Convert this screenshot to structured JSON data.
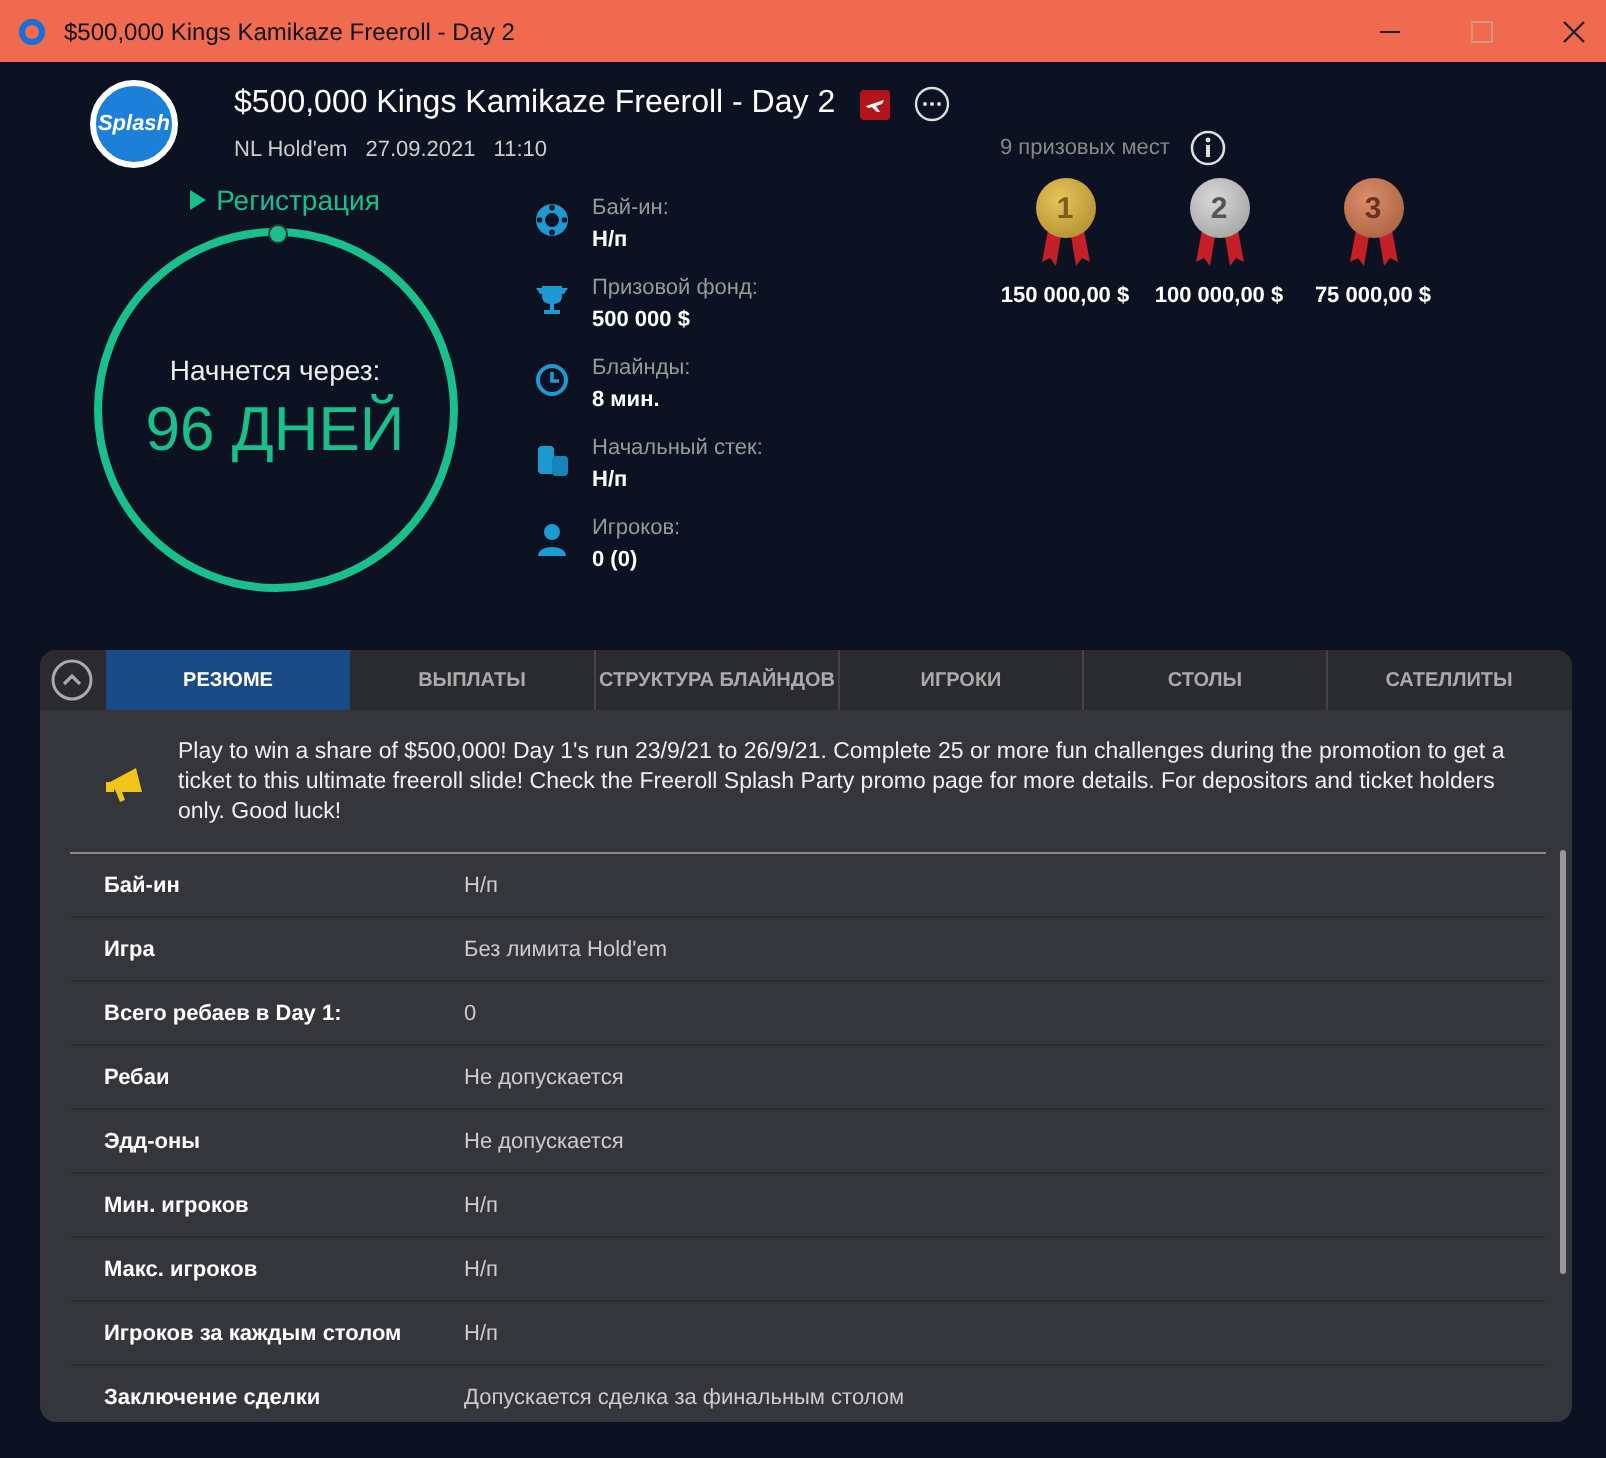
{
  "window": {
    "title": "$500,000 Kings Kamikaze Freeroll - Day 2"
  },
  "header": {
    "logo": "Splash",
    "title": "$500,000 Kings Kamikaze Freeroll - Day 2",
    "game": "NL Hold'em",
    "date": "27.09.2021",
    "time": "11:10"
  },
  "registration": {
    "label": "Регистрация",
    "countdown_label": "Начнется через:",
    "countdown": "96 ДНЕЙ"
  },
  "stats": [
    {
      "kind": "chip",
      "label": "Бай-ин:",
      "value": "Н/п"
    },
    {
      "kind": "trophy",
      "label": "Призовой фонд:",
      "value": "500 000 $"
    },
    {
      "kind": "clock",
      "label": "Блайнды:",
      "value": "8 мин."
    },
    {
      "kind": "coins",
      "label": "Начальный стек:",
      "value": "Н/п"
    },
    {
      "kind": "player",
      "label": "Игроков:",
      "value": "0 (0)"
    }
  ],
  "prizes": {
    "title": "9 призовых мест",
    "places": [
      {
        "kind": "gold",
        "place": "1",
        "amount": "150 000,00 $"
      },
      {
        "kind": "silver",
        "place": "2",
        "amount": "100 000,00 $"
      },
      {
        "kind": "bronze",
        "place": "3",
        "amount": "75 000,00 $"
      }
    ]
  },
  "tabs": [
    {
      "label": "РЕЗЮМЕ",
      "selected": true
    },
    {
      "label": "ВЫПЛАТЫ",
      "selected": false
    },
    {
      "label": "СТРУКТУРА БЛАЙНДОВ",
      "selected": false
    },
    {
      "label": "ИГРОКИ",
      "selected": false
    },
    {
      "label": "СТОЛЫ",
      "selected": false
    },
    {
      "label": "САТЕЛЛИТЫ",
      "selected": false
    }
  ],
  "announcement": "Play to win a share of $500,000! Day 1's run 23/9/21 to 26/9/21. Complete 25 or more fun challenges during the promotion to get a ticket to this ultimate freeroll slide! Check the Freeroll Splash Party promo page for more details. For depositors and ticket holders only. Good luck!",
  "details": [
    {
      "label": "Бай-ин",
      "value": "Н/п"
    },
    {
      "label": "Игра",
      "value": "Без лимита Hold'em"
    },
    {
      "label": "Всего ребаев в Day 1:",
      "value": "0"
    },
    {
      "label": "Ребаи",
      "value": "Не допускается"
    },
    {
      "label": "Эдд-оны",
      "value": "Не допускается"
    },
    {
      "label": "Мин. игроков",
      "value": "Н/п"
    },
    {
      "label": "Макс. игроков",
      "value": "Н/п"
    },
    {
      "label": "Игроков за каждым столом",
      "value": "Н/п"
    },
    {
      "label": "Заключение сделки",
      "value": "Допускается сделка за финальным столом"
    }
  ]
}
